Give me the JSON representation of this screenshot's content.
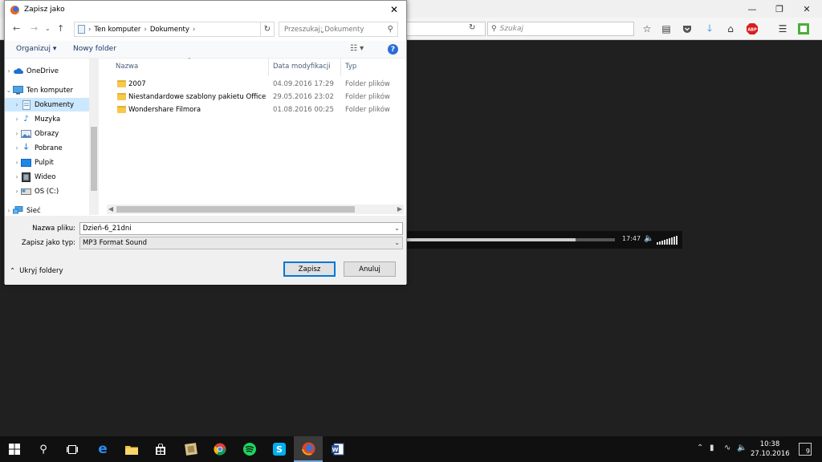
{
  "browser": {
    "search_placeholder": "Szukaj",
    "player": {
      "time": "17:47",
      "progress_fraction": 0.81
    }
  },
  "dialog": {
    "title": "Zapisz jako",
    "breadcrumb": [
      "Ten komputer",
      "Dokumenty"
    ],
    "search_placeholder": "Przeszukaj: Dokumenty",
    "toolbar": {
      "organize": "Organizuj",
      "new_folder": "Nowy folder"
    },
    "tree": [
      {
        "label": "OneDrive",
        "icon": "cloud-icon",
        "indent": 0
      },
      {
        "label": "Ten komputer",
        "icon": "computer-icon",
        "indent": 0,
        "expanded": true
      },
      {
        "label": "Dokumenty",
        "icon": "documents-icon",
        "indent": 1,
        "selected": true
      },
      {
        "label": "Muzyka",
        "icon": "music-icon",
        "indent": 1
      },
      {
        "label": "Obrazy",
        "icon": "pictures-icon",
        "indent": 1
      },
      {
        "label": "Pobrane",
        "icon": "download-icon",
        "indent": 1
      },
      {
        "label": "Pulpit",
        "icon": "desktop-icon",
        "indent": 1
      },
      {
        "label": "Wideo",
        "icon": "video-icon",
        "indent": 1
      },
      {
        "label": "OS (C:)",
        "icon": "drive-icon",
        "indent": 1
      },
      {
        "label": "Sieć",
        "icon": "network-icon",
        "indent": 0
      }
    ],
    "columns": {
      "name": "Nazwa",
      "date": "Data modyfikacji",
      "type": "Typ"
    },
    "files": [
      {
        "name": "2007",
        "date": "04.09.2016 17:29",
        "type": "Folder plików"
      },
      {
        "name": "Niestandardowe szablony pakietu Office",
        "date": "29.05.2016 23:02",
        "type": "Folder plików"
      },
      {
        "name": "Wondershare Filmora",
        "date": "01.08.2016 00:25",
        "type": "Folder plików"
      }
    ],
    "filename_label": "Nazwa pliku:",
    "filename_value": "Dzień-6_21dni",
    "filetype_label": "Zapisz jako typ:",
    "filetype_value": "MP3 Format Sound",
    "hide_folders": "Ukryj foldery",
    "save": "Zapisz",
    "cancel": "Anuluj"
  },
  "taskbar": {
    "time": "10:38",
    "date": "27.10.2016",
    "notifications": "9"
  }
}
